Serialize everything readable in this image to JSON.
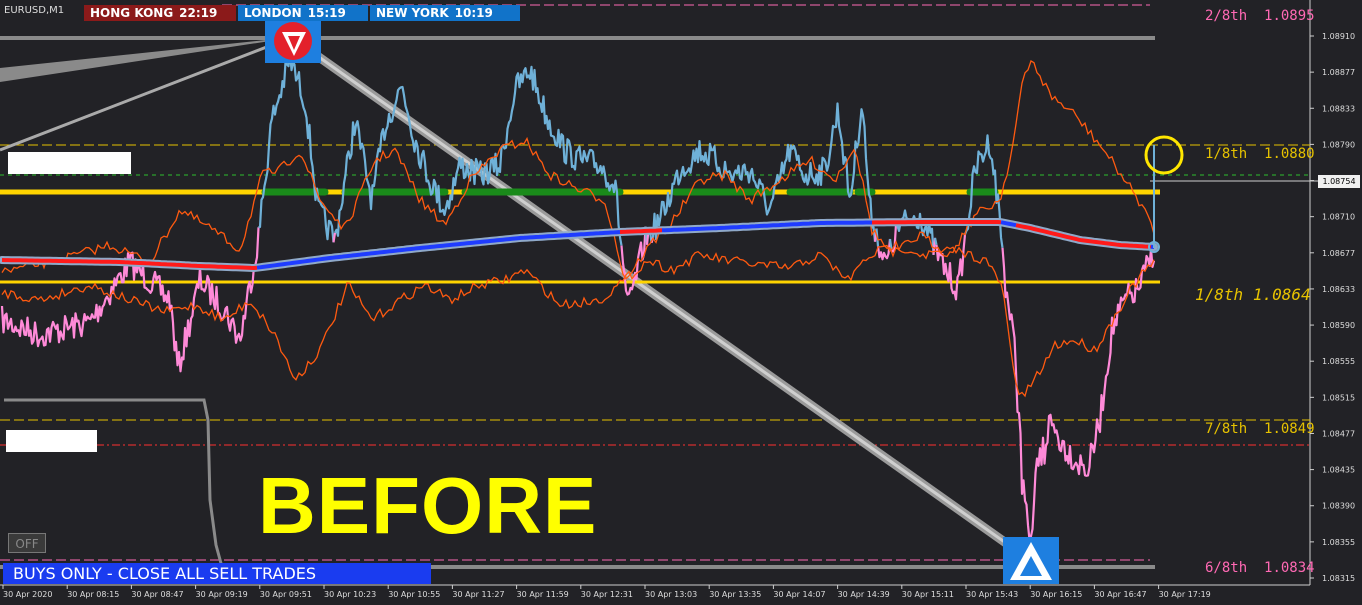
{
  "window": {
    "symbol": "EURUSD,M1"
  },
  "clocks": [
    {
      "city": "HONG KONG",
      "time": "22:19"
    },
    {
      "city": "LONDON",
      "time": "15:19"
    },
    {
      "city": "NEW YORK",
      "time": "10:19"
    }
  ],
  "murrey_levels": [
    {
      "label": "2/8th",
      "price": "1.0895",
      "color": "#ff69b4"
    },
    {
      "label": "1/8th",
      "price": "1.0880",
      "color": "#e6c200"
    },
    {
      "label": "1/8th",
      "price": "1.0864",
      "color": "#e6c200",
      "italic": true
    },
    {
      "label": "7/8th",
      "price": "1.0849",
      "color": "#e6c200"
    },
    {
      "label": "6/8th",
      "price": "1.0834",
      "color": "#ff69b4"
    }
  ],
  "price_axis": {
    "current_price": "1.08754",
    "ticks": [
      "1.08910",
      "1.08877",
      "1.08833",
      "1.08790",
      "1.08754",
      "1.08710",
      "1.08677",
      "1.08633",
      "1.08590",
      "1.08555",
      "1.08515",
      "1.08477",
      "1.08435",
      "1.08390",
      "1.08355",
      "1.08315"
    ]
  },
  "time_axis": {
    "ticks": [
      "30 Apr 2020",
      "30 Apr 08:15",
      "30 Apr 08:47",
      "30 Apr 09:19",
      "30 Apr 09:51",
      "30 Apr 10:23",
      "30 Apr 10:55",
      "30 Apr 11:27",
      "30 Apr 11:59",
      "30 Apr 12:31",
      "30 Apr 13:03",
      "30 Apr 13:35",
      "30 Apr 14:07",
      "30 Apr 14:39",
      "30 Apr 15:11",
      "30 Apr 15:43",
      "30 Apr 16:15",
      "30 Apr 16:47",
      "30 Apr 17:19"
    ]
  },
  "overlay": {
    "before_text": "BEFORE",
    "off_button": "OFF",
    "banner": "BUYS ONLY - CLOSE ALL SELL TRADES"
  },
  "colors": {
    "background": "#222226",
    "price_up": "#6fb1d8",
    "price_down": "#ff8ad8",
    "band": "#ff5a10",
    "ma_blue": "#1f3cff",
    "ma_red": "#ff1a1a",
    "support": "#ffd400",
    "green_bar": "#1a8a1a"
  }
}
